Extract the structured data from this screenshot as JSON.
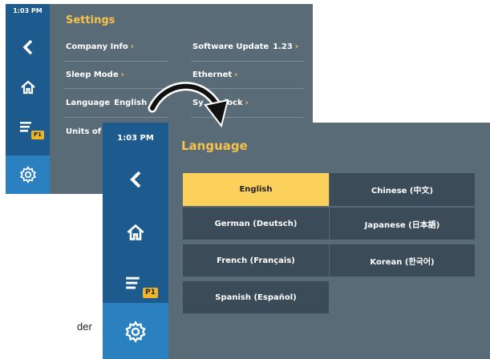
{
  "back_screen": {
    "clock": "1:03 PM",
    "title": "Settings",
    "rows": [
      {
        "label": "Company Info",
        "value": "",
        "chevron": "›"
      },
      {
        "label": "Software Update",
        "value": "1.23",
        "chevron": "›"
      },
      {
        "label": "Sleep Mode",
        "value": "",
        "chevron": "›"
      },
      {
        "label": "Ethernet",
        "value": "",
        "chevron": "›"
      },
      {
        "label": "Language",
        "value": "English",
        "chevron": "›"
      },
      {
        "label": "System Clock",
        "value": "",
        "chevron": "›"
      },
      {
        "label": "Units of M",
        "value": "",
        "chevron": ""
      }
    ],
    "partial_clock_label": "Sy",
    "partial_clock_label_tail": "lock"
  },
  "front_screen": {
    "clock": "1:03 PM",
    "title": "Language",
    "languages": [
      {
        "label": "English",
        "selected": true
      },
      {
        "label": "Chinese (中文)",
        "selected": false
      },
      {
        "label": "German (Deutsch)",
        "selected": false
      },
      {
        "label": "Japanese (日本語)",
        "selected": false
      },
      {
        "label": "French (Français)",
        "selected": false
      },
      {
        "label": "Korean (한국어)",
        "selected": false
      },
      {
        "label": "Spanish (Español)",
        "selected": false
      }
    ]
  },
  "sidebar": {
    "icons": [
      "back-arrow-icon",
      "home-icon",
      "list-icon",
      "gear-icon"
    ],
    "badge": "P1"
  },
  "background_text": "der",
  "colors": {
    "panel": "#5a6b78",
    "sidebar": "#1d5b8f",
    "sidebar_active": "#2b80bf",
    "accent": "#f5c24b",
    "button": "#3b4b57",
    "selected_button": "#fbd15b"
  }
}
